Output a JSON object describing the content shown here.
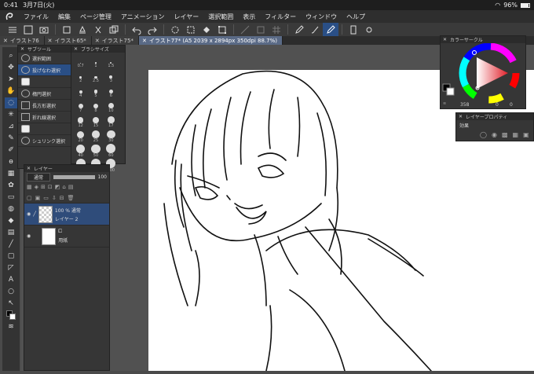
{
  "status": {
    "time": "0:41",
    "date": "3月7日(火)",
    "battery": "96%"
  },
  "menu": {
    "items": [
      "ファイル",
      "編集",
      "ページ管理",
      "アニメーション",
      "レイヤー",
      "選択範囲",
      "表示",
      "フィルター",
      "ウィンドウ",
      "ヘルプ"
    ]
  },
  "tabs": [
    {
      "label": "イラスト76"
    },
    {
      "label": "イラスト65*"
    },
    {
      "label": "イラスト75*"
    },
    {
      "label": "イラスト77* (A5 2039 x 2894px 350dpi 88.7%)"
    }
  ],
  "subtool": {
    "title": "サブツール",
    "items": [
      "選択範囲",
      "投げなわ選択",
      "",
      "楕円選択",
      "長方形選択",
      "折れ線選択",
      "",
      "シュリンク選択"
    ]
  },
  "brushsize": {
    "title": "ブラシサイズ",
    "cells": [
      "0.7",
      "1",
      "1.5",
      "2",
      "2.5",
      "3",
      "4",
      "5",
      "6",
      "7",
      "8",
      "10",
      "12",
      "15",
      "17",
      "20",
      "25",
      "30",
      "40",
      "50",
      "60",
      "70",
      "80",
      "100"
    ]
  },
  "layers": {
    "title": "レイヤー",
    "blend": "通常",
    "opacity": "100",
    "rows": [
      {
        "mode": "100 % 通常",
        "name": "レイヤー 2"
      },
      {
        "mode": "",
        "name": "用紙"
      }
    ]
  },
  "colorcircle": {
    "title": "カラーサークル",
    "values": "358",
    "v2": "0",
    "v3": "0"
  },
  "layerprop": {
    "title": "レイヤープロパティ",
    "effect": "効果"
  },
  "colors": {
    "accent": "#2a4f86",
    "main": "#000000",
    "sub": "#ffffff"
  }
}
